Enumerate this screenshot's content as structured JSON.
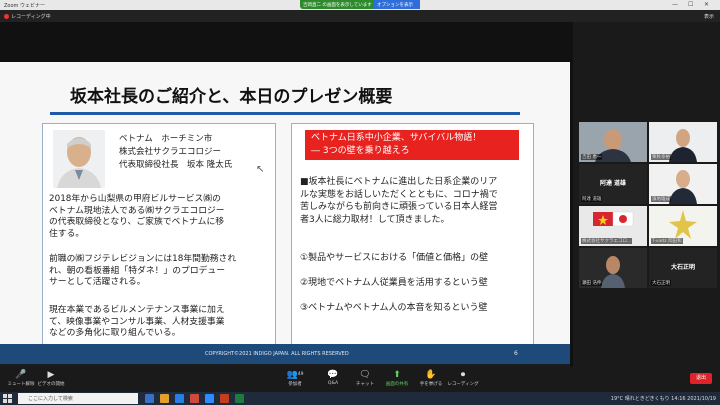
{
  "window": {
    "title": "Zoom ウェビナー",
    "controls": [
      "—",
      "☐",
      "✕"
    ]
  },
  "share_banner": {
    "label": "吉岡直二 の画面を表示しています",
    "option": "オプションを表示 ⌄"
  },
  "meeting": {
    "recording_label": "レコーディング中",
    "view_label": "表示"
  },
  "slide": {
    "title": "坂本社長のご紹介と、本日のプレゼン概要",
    "profile": {
      "country_city": "ベトナム　ホーチミン市",
      "company": "株式会社サクラエコロジー",
      "role_name": "代表取締役社長　坂本 隆太氏"
    },
    "left_paragraphs": [
      [
        "2018年から山梨県の甲府ビルサービス㈱の",
        "ベトナム現地法人である㈱サクラエコロジー",
        "の代表取締役となり、ご家族でベトナムに移",
        "住する。"
      ],
      [
        "前職の㈱フジテレビジョンには18年間勤務され",
        "れ、朝の看板番組「特ダネ！」のプロデュー",
        "サーとして活躍される。"
      ],
      [
        "現在本業であるビルメンテナンス事業に加え",
        "て、映像事業やコンサル事業、人材支援事業",
        "などの多角化に取り組んでいる。"
      ]
    ],
    "banner_lines": [
      "ベトナム日系中小企業、サバイバル物語！",
      "― 3つの壁を乗り越えろ"
    ],
    "intro_lines": [
      "■坂本社長にベトナムに進出した日系企業のリア",
      "ルな実態をお話しいただくとともに、コロナ禍で",
      "苦しみながらも前向きに頑張っている日本人経営",
      "者3人に総力取材！して頂きました。"
    ],
    "points": [
      "①製品やサービスにおける「価値と価格」の壁",
      "②現地でベトナム人従業員を活用するという壁",
      "③ベトナムやベトナム人の本音を知るという壁"
    ],
    "footer": {
      "copyright": "COPYRIGHT©2021 INDIGO JAPAN. ALL RIGHTS RESERVED",
      "page": "6"
    }
  },
  "gallery": [
    {
      "label": "吉田 恵一",
      "center": ""
    },
    {
      "label": "栗秋幸裕",
      "center": ""
    },
    {
      "label": "阿達 道雄",
      "center": "阿達 道雄"
    },
    {
      "label": "濱地雄成",
      "center": ""
    },
    {
      "label": "株式会社サクラエコロ...",
      "center": ""
    },
    {
      "label": "T-vietz 岡田和",
      "center": ""
    },
    {
      "label": "瀬田 浩伸",
      "center": ""
    },
    {
      "label": "大石正明",
      "center": "大石正明"
    }
  ],
  "toolbar": {
    "items": [
      {
        "icon": "🎤",
        "label": "ミュート解除"
      },
      {
        "icon": "▶",
        "label": "ビデオの開始"
      },
      {
        "icon": "👥",
        "label": "参加者",
        "count": "49"
      },
      {
        "icon": "💬",
        "label": "Q&A"
      },
      {
        "icon": "🗨",
        "label": "チャット"
      },
      {
        "icon": "⬆",
        "label": "画面の共有"
      },
      {
        "icon": "✋",
        "label": "手を挙げる"
      },
      {
        "icon": "⏺",
        "label": "レコーディング"
      }
    ],
    "leave": "退出"
  },
  "taskbar": {
    "search_placeholder": "ここに入力して検索",
    "weather": "19°C 晴れときどきくもり",
    "time": "14:16",
    "date": "2021/10/19"
  },
  "colors": {
    "banner_red": "#e8231f",
    "title_line": "#1e5aa8",
    "footer_blue": "#1e4a7a"
  }
}
